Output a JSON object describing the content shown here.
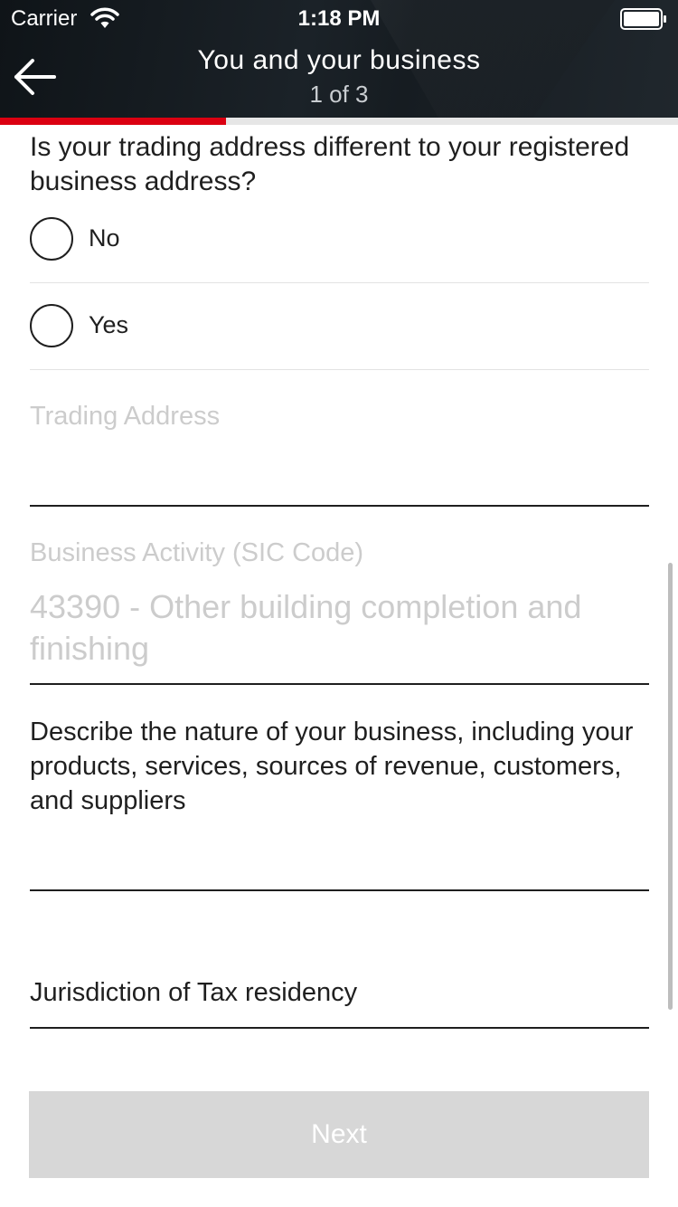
{
  "status_bar": {
    "carrier": "Carrier",
    "time": "1:18 PM",
    "wifi_icon": "wifi-icon",
    "battery_icon": "battery-icon"
  },
  "header": {
    "title": "You and your business",
    "step": "1 of 3",
    "back_icon": "back-arrow-icon",
    "progress": 0.3333
  },
  "form": {
    "trading_question": "Is your trading address different to your registered business address?",
    "options": [
      {
        "label": "No",
        "selected": false
      },
      {
        "label": "Yes",
        "selected": false
      }
    ],
    "trading_address": {
      "label": "Trading Address",
      "value": ""
    },
    "business_activity": {
      "label": "Business Activity (SIC Code)",
      "value": "43390 - Other building completion and finishing"
    },
    "business_description": {
      "label": "Describe the nature of your business, including your products, services, sources of revenue, customers, and suppliers",
      "value": ""
    },
    "tax_jurisdiction": {
      "label": "Jurisdiction of Tax residency",
      "value": ""
    }
  },
  "actions": {
    "next_label": "Next"
  },
  "colors": {
    "accent": "#db0011",
    "header_bg": "#161c21",
    "button_disabled": "#d7d7d7",
    "muted_text": "#cccccc"
  }
}
